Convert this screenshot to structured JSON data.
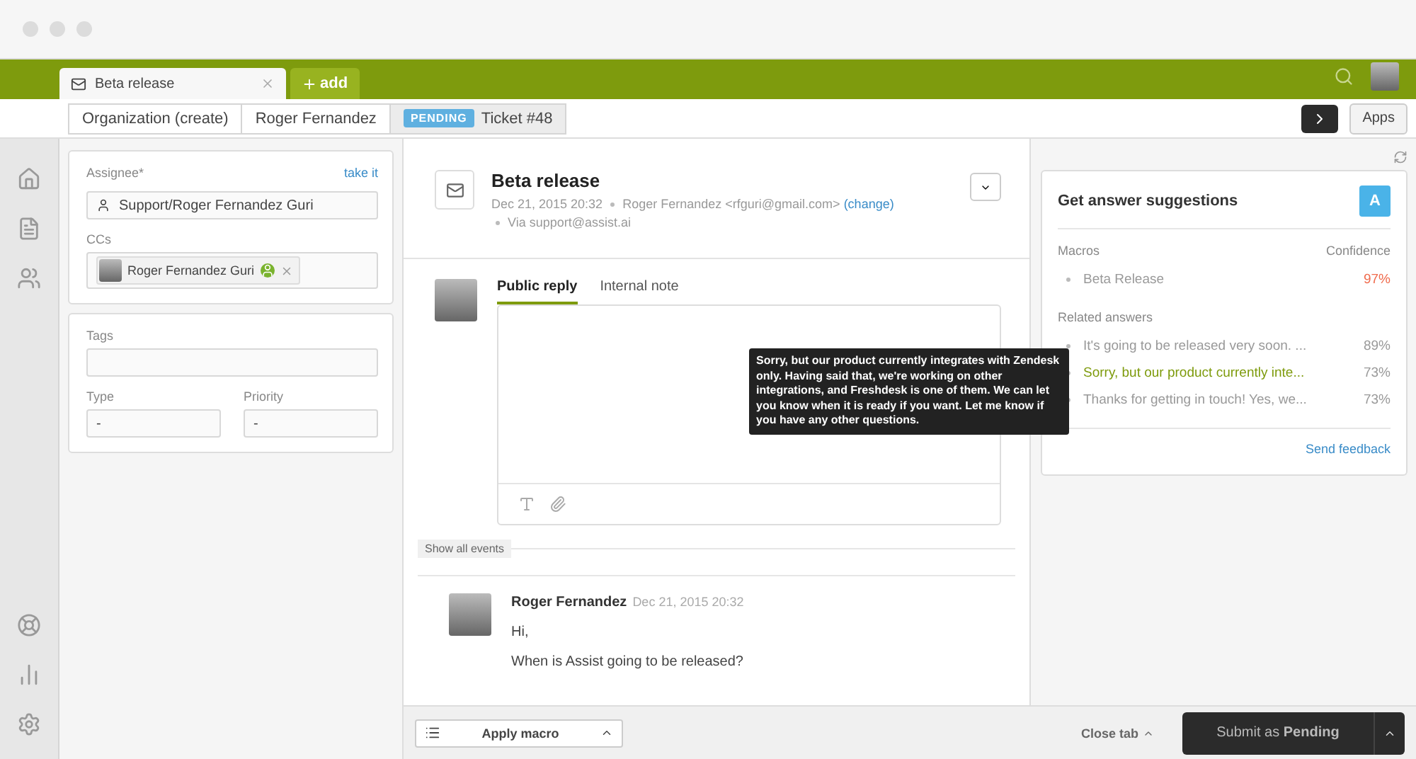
{
  "top_tabs": [
    {
      "label": "Beta release",
      "selected": true
    }
  ],
  "add_tab": {
    "label": "add"
  },
  "breadcrumbs": [
    {
      "label": "Organization (create)",
      "selected": false
    },
    {
      "label": "Roger Fernandez",
      "selected": false
    },
    {
      "label": "Ticket #48",
      "badge": "PENDING",
      "selected": true
    }
  ],
  "apps_button": "Apps",
  "ticket_fields": {
    "assignee": {
      "label": "Assignee*",
      "action": "take it",
      "value": "Support/Roger Fernandez Guri"
    },
    "ccs": {
      "label": "CCs",
      "chips": [
        "Roger Fernandez Guri"
      ]
    },
    "tags": {
      "label": "Tags"
    },
    "type": {
      "label": "Type",
      "value": "-"
    },
    "priority": {
      "label": "Priority",
      "value": "-"
    }
  },
  "ticket": {
    "subject": "Beta release",
    "date": "Dec 21, 2015 20:32",
    "requester": "Roger Fernandez <rfguri@gmail.com>",
    "change_link": "(change)",
    "via": "Via support@assist.ai"
  },
  "reply_tabs": [
    {
      "label": "Public reply",
      "selected": true
    },
    {
      "label": "Internal note",
      "selected": false
    }
  ],
  "show_all_events": "Show all events",
  "messages": [
    {
      "author": "Roger Fernandez",
      "time": "Dec 21, 2015 20:32",
      "paragraphs": [
        "Hi,",
        "When is Assist going to be released?"
      ]
    }
  ],
  "tooltip": "Sorry, but our product currently integrates with Zendesk only. Having said that, we're working on other integrations, and Freshdesk is one of them. We can let you know when it is ready if you want. Let me know if you have any other questions.",
  "suggestions": {
    "title": "Get answer suggestions",
    "badge": "A",
    "macros_header": "Macros",
    "confidence_header": "Confidence",
    "macros": [
      {
        "name": "Beta Release",
        "confidence": "97%"
      }
    ],
    "related_header": "Related answers",
    "related": [
      {
        "text": "It's going to be released very soon. ...",
        "confidence": "89%",
        "selected": false
      },
      {
        "text": "Sorry, but our product currently inte...",
        "confidence": "73%",
        "selected": true
      },
      {
        "text": "Thanks for getting in touch! Yes, we...",
        "confidence": "73%",
        "selected": false
      }
    ],
    "send_feedback": "Send feedback"
  },
  "footer": {
    "apply_macro": "Apply macro",
    "close_tab": "Close tab",
    "submit": "Submit as **Pending**"
  }
}
